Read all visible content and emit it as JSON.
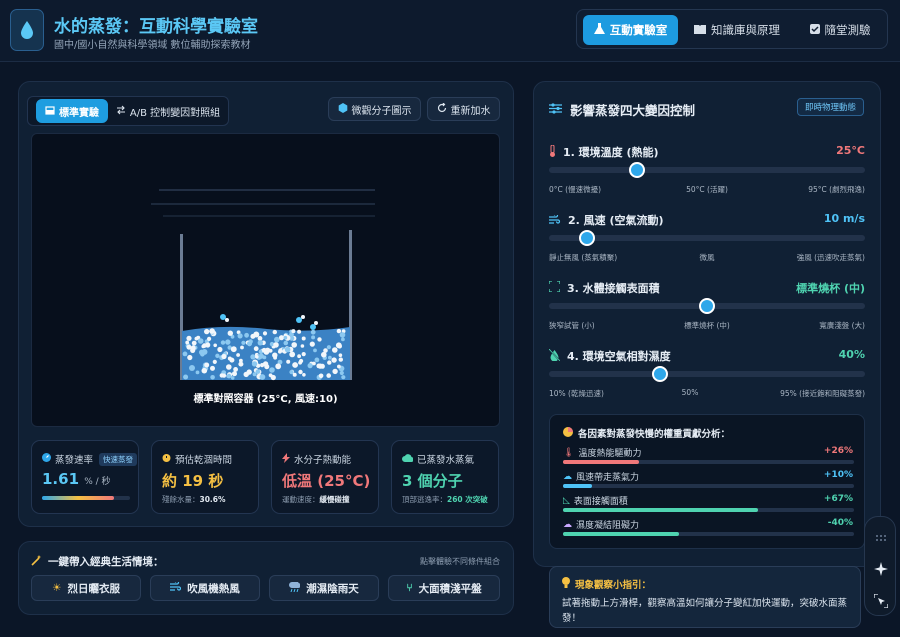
{
  "app": {
    "title": "水的蒸發：互動科學實驗室",
    "subtitle": "國中/國小自然與科學領域 數位輔助探索教材",
    "nav": [
      {
        "label": "互動實驗室",
        "icon": "flask-icon",
        "active": true
      },
      {
        "label": "知識庫與原理",
        "icon": "book-icon",
        "active": false
      },
      {
        "label": "隨堂測驗",
        "icon": "checkbox-icon",
        "active": false
      }
    ]
  },
  "lab": {
    "tabs": [
      {
        "label": "標準實驗",
        "icon": "beaker-icon",
        "active": true
      },
      {
        "label": "A/B 控制變因對照組",
        "icon": "compare-icon",
        "active": false
      }
    ],
    "molecule_button": "微觀分子圖示",
    "refill_button": "重新加水",
    "container_caption": "標準對照容器 (25°C, 風速:10)"
  },
  "stats": [
    {
      "title": "蒸發速率",
      "badge": "快速蒸發",
      "value": "1.61",
      "unit": "% / 秒",
      "icon": "gauge-icon",
      "color": "#5bc8f5",
      "rate_fraction": 0.82
    },
    {
      "title": "預估乾涸時間",
      "value": "約 19 秒",
      "note_label": "殘餘水量：",
      "note_value": "30.6%",
      "icon": "timer-icon",
      "color": "#f5c043"
    },
    {
      "title": "水分子熱動能",
      "value": "低溫 (25°C)",
      "note_label": "運動速度：",
      "note_value": "緩慢碰撞",
      "icon": "lightning-icon",
      "color": "#f0787a"
    },
    {
      "title": "已蒸發水蒸氣",
      "value": "3 個分子",
      "note_label": "頂部逃逸率：",
      "note_value": "260 次突破",
      "icon": "cloud-icon",
      "color": "#4fd3b0"
    }
  ],
  "scenarios": {
    "title": "一鍵帶入經典生活情境：",
    "hint": "點擊體驗不同條件組合",
    "items": [
      {
        "label": "烈日曬衣服",
        "icon": "sun-icon"
      },
      {
        "label": "吹風機熱風",
        "icon": "wind-icon"
      },
      {
        "label": "潮濕陰雨天",
        "icon": "rain-icon"
      },
      {
        "label": "大面積淺平盤",
        "icon": "tray-icon"
      }
    ]
  },
  "controls": {
    "title": "影響蒸發四大變因控制",
    "badge": "即時物理動態",
    "items": [
      {
        "label": "1. 環境溫度 (熱能)",
        "value": "25°C",
        "icon": "thermometer-icon",
        "value_color": "#f0787a",
        "fraction": 0.28,
        "ticks": [
          "0°C (慢速微擾)",
          "50°C (活躍)",
          "95°C (劇烈飛逸)"
        ]
      },
      {
        "label": "2. 風速 (空氣流動)",
        "value": "10 m/s",
        "icon": "wind-icon",
        "value_color": "#4fc3f7",
        "fraction": 0.12,
        "ticks": [
          "靜止無風 (蒸氣積聚)",
          "微風",
          "強風 (迅速吹走蒸氣)"
        ]
      },
      {
        "label": "3. 水體接觸表面積",
        "value": "標準燒杯 (中)",
        "icon": "expand-icon",
        "value_color": "#4fd3b0",
        "fraction": 0.5,
        "ticks": [
          "狹窄試管 (小)",
          "標準燒杯 (中)",
          "寬廣淺盤 (大)"
        ]
      },
      {
        "label": "4. 環境空氣相對濕度",
        "value": "40%",
        "icon": "humidity-icon",
        "value_color": "#4fd3b0",
        "fraction": 0.35,
        "ticks": [
          "10% (乾燥迅速)",
          "50%",
          "95% (接近飽和阻礙蒸發)"
        ]
      }
    ]
  },
  "analysis": {
    "title": "各因素對蒸發快慢的權重貢獻分析：",
    "rows": [
      {
        "label": "溫度熱能驅動力",
        "value": "+26%",
        "color": "#f0787a",
        "fraction": 0.26
      },
      {
        "label": "風速帶走蒸氣力",
        "value": "+10%",
        "color": "#4fc3f7",
        "fraction": 0.1
      },
      {
        "label": "表面接觸面積",
        "value": "+67%",
        "color": "#4fd3b0",
        "fraction": 0.67
      },
      {
        "label": "濕度凝結阻礙力",
        "value": "-40%",
        "color": "#4fd3b0",
        "fraction": 0.4
      }
    ]
  },
  "tip": {
    "title": "現象觀察小指引：",
    "body": "試著拖動上方滑桿，觀察高溫如何讓分子變紅加快運動，突破水面蒸發！"
  }
}
